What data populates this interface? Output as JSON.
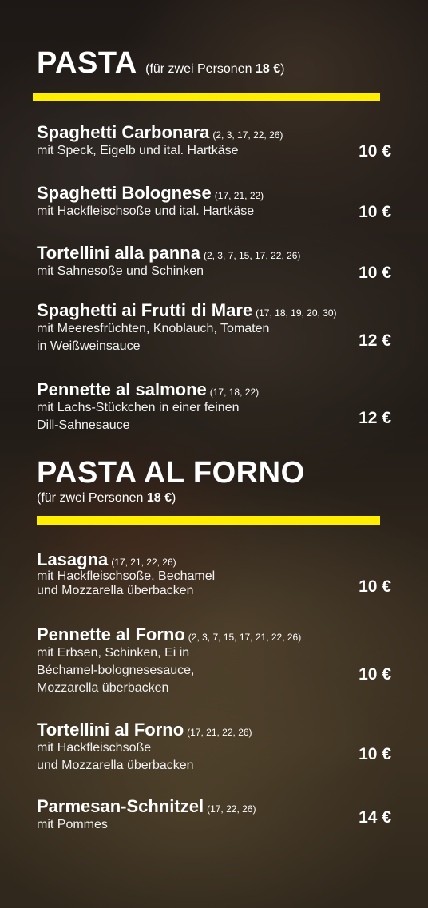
{
  "section1": {
    "title": "PASTA",
    "subtitle_pre": "(für zwei Personen ",
    "subtitle_price": "18 €",
    "subtitle_post": ")"
  },
  "section2": {
    "title": "PASTA AL FORNO",
    "subtitle_pre": "(für zwei Personen ",
    "subtitle_price": "18 €",
    "subtitle_post": ")"
  },
  "items": [
    {
      "name": "Spaghetti Carbonara",
      "codes": "(2, 3, 17, 22, 26)",
      "desc1": "mit Speck, Eigelb und ital. Hartkäse",
      "desc2": "",
      "desc3": "",
      "price": "10 €"
    },
    {
      "name": "Spaghetti Bolognese",
      "codes": "(17, 21, 22)",
      "desc1": "mit Hackfleischsoße und ital. Hartkäse",
      "desc2": "",
      "desc3": "",
      "price": "10 €"
    },
    {
      "name": "Tortellini alla panna",
      "codes": "(2, 3, 7, 15, 17, 22, 26)",
      "desc1": "mit Sahnesoße und Schinken",
      "desc2": "",
      "desc3": "",
      "price": "10 €"
    },
    {
      "name": "Spaghetti ai Frutti di Mare",
      "codes": "(17, 18, 19, 20, 30)",
      "desc1": "mit Meeresfrüchten, Knoblauch, Tomaten",
      "desc2": "in Weißweinsauce",
      "desc3": "",
      "price": "12 €"
    },
    {
      "name": "Pennette al salmone",
      "codes": "(17, 18, 22)",
      "desc1": "mit Lachs-Stückchen in einer feinen",
      "desc2": "Dill-Sahnesauce",
      "desc3": "",
      "price": "12 €"
    },
    {
      "name": "Lasagna",
      "codes": "(17, 21, 22, 26)",
      "desc1": "mit Hackfleischsoße, Bechamel",
      "desc2": "und Mozzarella überbacken",
      "desc3": "",
      "price": "10 €"
    },
    {
      "name": "Pennette al Forno",
      "codes": "(2, 3, 7, 15, 17, 21, 22, 26)",
      "desc1": "mit Erbsen, Schinken, Ei in",
      "desc2": "Béchamel-bolognesesauce,",
      "desc3": "Mozzarella überbacken",
      "price": "10 €"
    },
    {
      "name": "Tortellini al Forno",
      "codes": "(17, 21, 22, 26)",
      "desc1": "mit Hackfleischsoße",
      "desc2": "und Mozzarella überbacken",
      "desc3": "",
      "price": "10 €"
    },
    {
      "name": "Parmesan-Schnitzel",
      "codes": "(17, 22, 26)",
      "desc1": "mit Pommes",
      "desc2": "",
      "desc3": "",
      "price": "14 €"
    }
  ],
  "colors": {
    "accent": "#ffee00",
    "text": "#ffffff"
  }
}
